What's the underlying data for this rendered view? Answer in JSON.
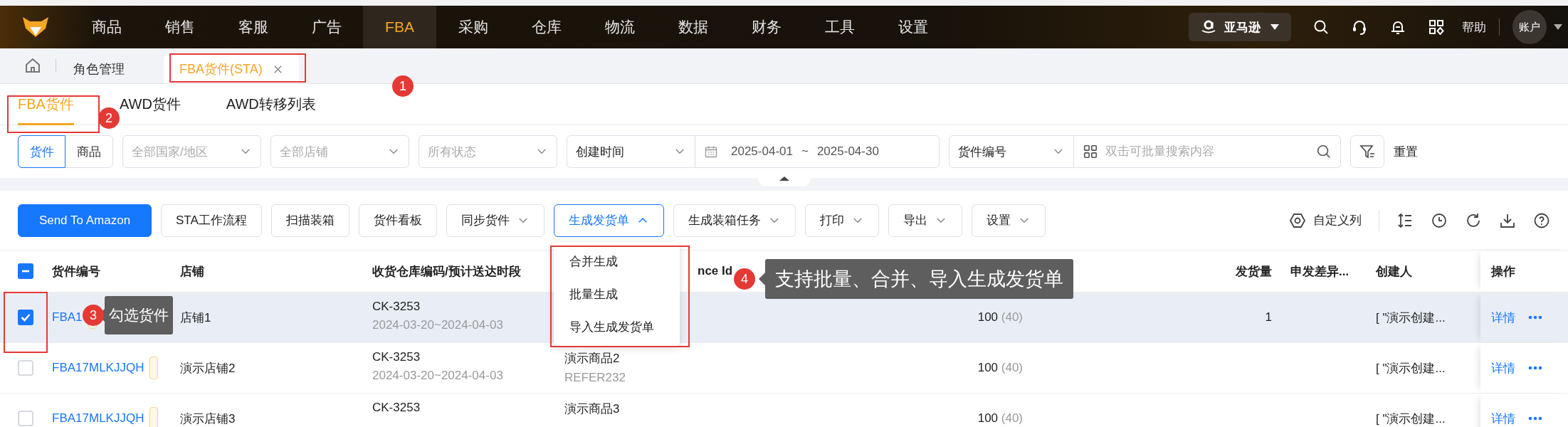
{
  "nav": {
    "items": [
      {
        "label": "商品",
        "selected": false
      },
      {
        "label": "销售",
        "selected": false
      },
      {
        "label": "客服",
        "selected": false
      },
      {
        "label": "广告",
        "selected": false
      },
      {
        "label": "FBA",
        "selected": true
      },
      {
        "label": "采购",
        "selected": false
      },
      {
        "label": "仓库",
        "selected": false
      },
      {
        "label": "物流",
        "selected": false
      },
      {
        "label": "数据",
        "selected": false
      },
      {
        "label": "财务",
        "selected": false
      },
      {
        "label": "工具",
        "selected": false
      },
      {
        "label": "设置",
        "selected": false
      }
    ],
    "platform": "亚马逊",
    "help": "帮助",
    "account": "账户"
  },
  "page_tabs": [
    {
      "label": "角色管理",
      "selected": false,
      "closable": false
    },
    {
      "label": "FBA货件(STA)",
      "selected": true,
      "closable": true
    }
  ],
  "sub_tabs": [
    {
      "label": "FBA货件",
      "selected": true
    },
    {
      "label": "AWD货件",
      "selected": false
    },
    {
      "label": "AWD转移列表",
      "selected": false
    }
  ],
  "filters": {
    "mode": [
      {
        "label": "货件",
        "selected": true
      },
      {
        "label": "商品",
        "selected": false
      }
    ],
    "selects": [
      {
        "placeholder": "全部国家/地区"
      },
      {
        "placeholder": "全部店铺"
      },
      {
        "placeholder": "所有状态"
      }
    ],
    "date_type": "创建时间",
    "date_start": "2025-04-01",
    "date_separator": "~",
    "date_end": "2025-04-30",
    "search_type": "货件编号",
    "search_placeholder": "双击可批量搜索内容",
    "reset": "重置"
  },
  "toolbar": {
    "buttons": [
      {
        "label": "Send To Amazon",
        "kind": "primary"
      },
      {
        "label": "STA工作流程",
        "kind": "plain"
      },
      {
        "label": "扫描装箱",
        "kind": "plain"
      },
      {
        "label": "货件看板",
        "kind": "plain"
      },
      {
        "label": "同步货件",
        "kind": "dropdown",
        "expanded": false
      },
      {
        "label": "生成发货单",
        "kind": "dropdown",
        "expanded": true
      },
      {
        "label": "生成装箱任务",
        "kind": "dropdown",
        "expanded": false
      },
      {
        "label": "打印",
        "kind": "dropdown",
        "expanded": false
      },
      {
        "label": "导出",
        "kind": "dropdown",
        "expanded": false
      },
      {
        "label": "设置",
        "kind": "dropdown",
        "expanded": false
      }
    ],
    "columns_button": "自定义列"
  },
  "dropdown_menu": {
    "items": [
      "合并生成",
      "批量生成",
      "导入生成发货单"
    ]
  },
  "table": {
    "select_all": {
      "indeterminate": true
    },
    "columns": [
      {
        "label": "货件编号"
      },
      {
        "label": "店铺"
      },
      {
        "label": "收货仓库编码/预计送达时段"
      },
      {
        "label": "nce Id"
      },
      {
        "label": "发货量"
      },
      {
        "label": "申发差异..."
      },
      {
        "label": "创建人"
      },
      {
        "label": "操作"
      }
    ],
    "rows": [
      {
        "checked": true,
        "selected": true,
        "code": "FBA1",
        "store": "店铺1",
        "warehouse": "CK-3253",
        "window": "2024-03-20~2024-04-03",
        "packed": "100",
        "declared": "(40)",
        "shipped": "1",
        "creator": "[ \"演示创建...",
        "action": "详情"
      },
      {
        "checked": false,
        "selected": false,
        "code": "FBA17MLKJJQH",
        "store": "演示店铺2",
        "warehouse": "CK-3253",
        "window": "2024-03-20~2024-04-03",
        "product": "演示商品2",
        "reference": "REFER232",
        "packed": "100",
        "declared": "(40)",
        "creator": "[ \"演示创建...",
        "action": "详情"
      },
      {
        "checked": false,
        "selected": false,
        "code": "FBA17MLKJJQH",
        "store": "演示店铺3",
        "warehouse": "CK-3253",
        "product": "演示商品3",
        "packed": "100",
        "declared": "(40)",
        "creator": "[ \"演示创建...",
        "action": "详情"
      }
    ]
  },
  "annotations": [
    {
      "number": "1"
    },
    {
      "number": "2"
    },
    {
      "number": "3",
      "text": "勾选货件"
    },
    {
      "number": "4",
      "text": "支持批量、合并、导入生成发货单"
    }
  ]
}
